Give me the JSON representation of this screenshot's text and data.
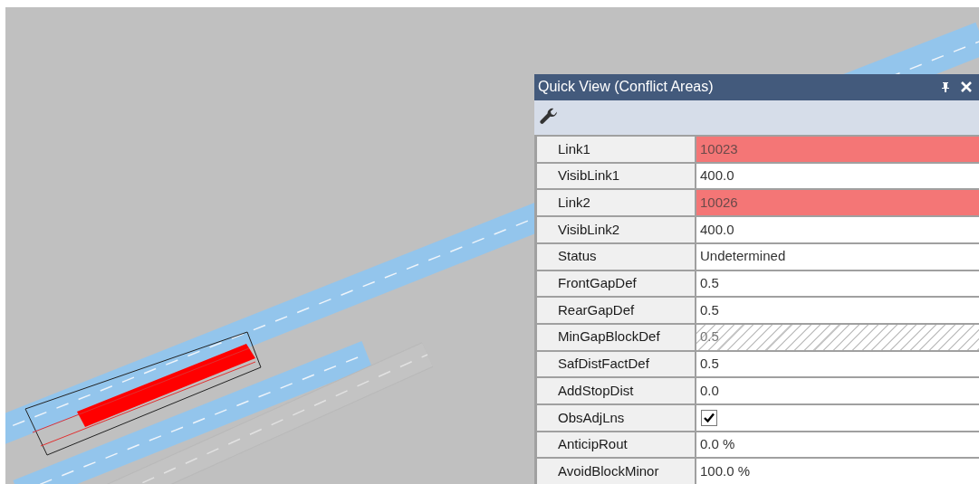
{
  "panel": {
    "title": "Quick View (Conflict Areas)"
  },
  "properties": [
    {
      "kind": "text",
      "label": "Link1",
      "value": "10023",
      "highlight": true,
      "read_only": false
    },
    {
      "kind": "text",
      "label": "VisibLink1",
      "value": "400.0",
      "highlight": false,
      "read_only": false
    },
    {
      "kind": "text",
      "label": "Link2",
      "value": "10026",
      "highlight": true,
      "read_only": false
    },
    {
      "kind": "text",
      "label": "VisibLink2",
      "value": "400.0",
      "highlight": false,
      "read_only": false
    },
    {
      "kind": "text",
      "label": "Status",
      "value": "Undetermined",
      "highlight": false,
      "read_only": false
    },
    {
      "kind": "text",
      "label": "FrontGapDef",
      "value": "0.5",
      "highlight": false,
      "read_only": false
    },
    {
      "kind": "text",
      "label": "RearGapDef",
      "value": "0.5",
      "highlight": false,
      "read_only": false
    },
    {
      "kind": "text",
      "label": "MinGapBlockDef",
      "value": "0.5",
      "highlight": false,
      "read_only": true
    },
    {
      "kind": "text",
      "label": "SafDistFactDef",
      "value": "0.5",
      "highlight": false,
      "read_only": false
    },
    {
      "kind": "text",
      "label": "AddStopDist",
      "value": "0.0",
      "highlight": false,
      "read_only": false
    },
    {
      "kind": "checkbox",
      "label": "ObsAdjLns",
      "checked": true
    },
    {
      "kind": "text",
      "label": "AnticipRout",
      "value": "0.0 %",
      "highlight": false,
      "read_only": false
    },
    {
      "kind": "text",
      "label": "AvoidBlockMinor",
      "value": "100.0 %",
      "highlight": false,
      "read_only": false
    }
  ]
}
